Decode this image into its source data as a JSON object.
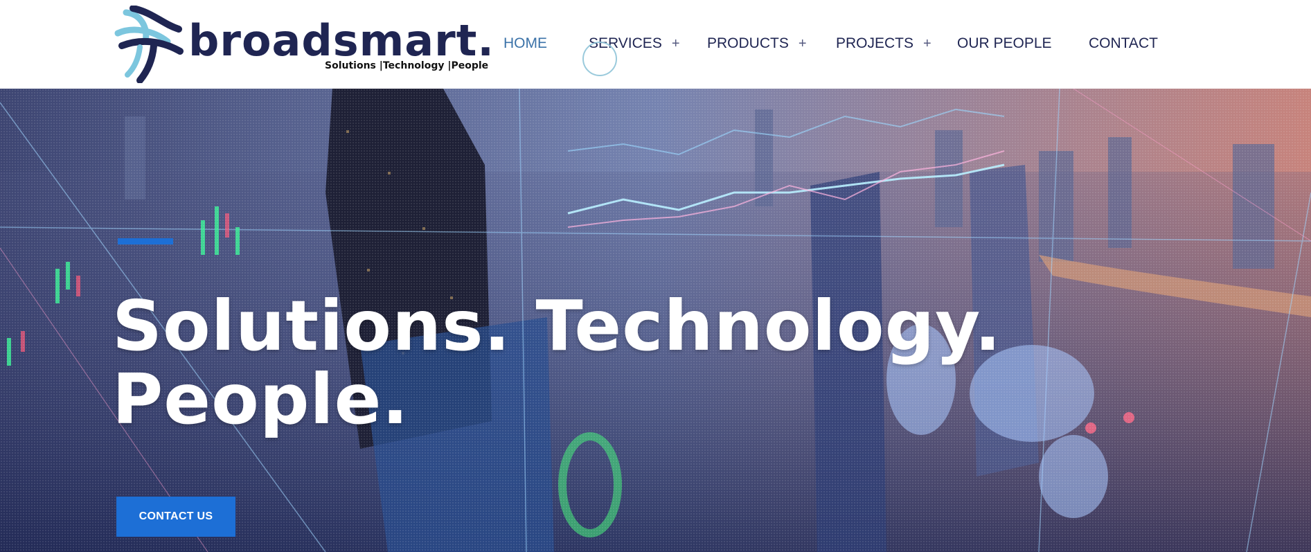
{
  "brand": {
    "wordmark": "broadsmart.",
    "tagline": "Solutions |Technology |People",
    "colors": {
      "navy": "#1f2552",
      "light_blue": "#7cc6de",
      "accent": "#1d6fd6"
    }
  },
  "nav": {
    "items": [
      {
        "label": "HOME",
        "active": true,
        "has_submenu": false
      },
      {
        "label": "SERVICES",
        "active": false,
        "has_submenu": true
      },
      {
        "label": "PRODUCTS",
        "active": false,
        "has_submenu": true
      },
      {
        "label": "PROJECTS",
        "active": false,
        "has_submenu": true
      },
      {
        "label": "OUR PEOPLE",
        "active": false,
        "has_submenu": false
      },
      {
        "label": "CONTACT",
        "active": false,
        "has_submenu": false
      }
    ],
    "submenu_indicator": "+"
  },
  "hero": {
    "title_line1": "Solutions. Technology.",
    "title_line2": "People.",
    "cta_label": "CONTACT US",
    "background": "city-skyline-with-data-overlay"
  }
}
